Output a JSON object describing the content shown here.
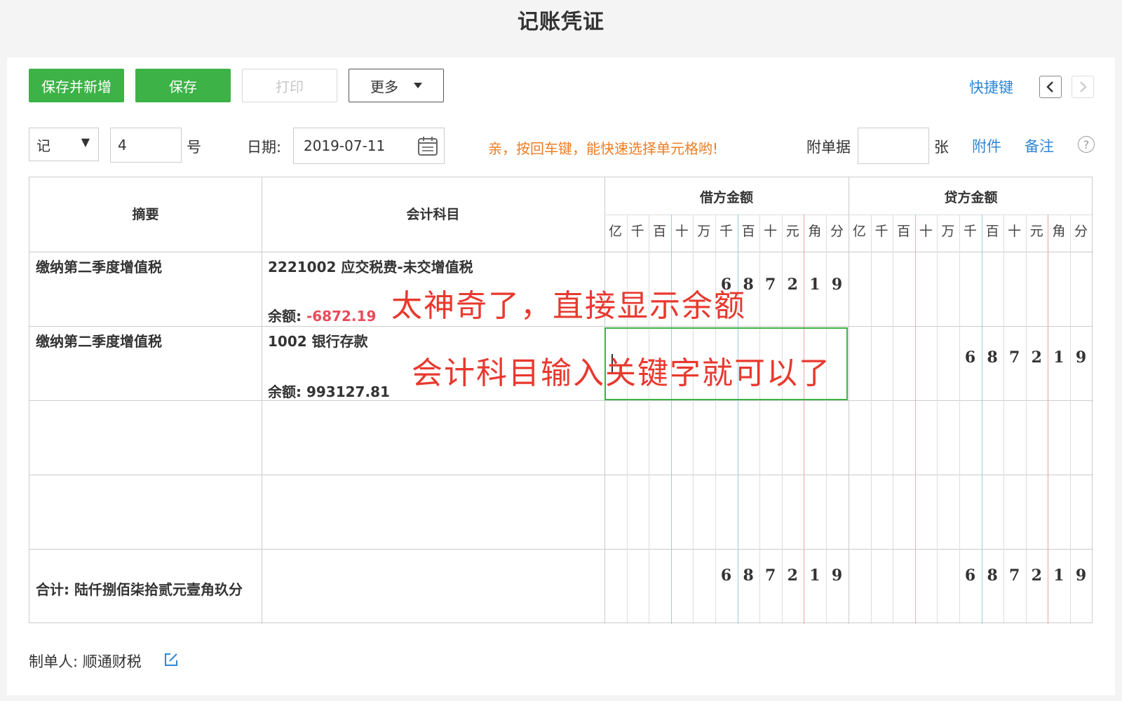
{
  "title": "记账凭证",
  "toolbar": {
    "save_new": "保存并新增",
    "save": "保存",
    "print": "打印",
    "more": "更多",
    "shortcut": "快捷键"
  },
  "voucher": {
    "type": "记",
    "number": "4",
    "number_suffix": "号",
    "date_label": "日期:",
    "date": "2019-07-11",
    "hint": "亲，按回车键，能快速选择单元格哟!",
    "attach_label": "附单据",
    "attach_count": "",
    "attach_unit": "张",
    "attachment_link": "附件",
    "remark_link": "备注",
    "help": "?"
  },
  "grid": {
    "col_summary": "摘要",
    "col_account": "会计科目",
    "col_debit": "借方金额",
    "col_credit": "贷方金额",
    "units": [
      "亿",
      "千",
      "百",
      "十",
      "万",
      "千",
      "百",
      "十",
      "元",
      "角",
      "分"
    ],
    "balance_label": "余额:",
    "rows": [
      {
        "summary": "缴纳第二季度增值税",
        "account": "2221002 应交税费-未交增值税",
        "balance": "-6872.19",
        "debit_digits": [
          "",
          "",
          "",
          "",
          "",
          "6",
          "8",
          "7",
          "2",
          "1",
          "9"
        ],
        "credit_digits": [
          "",
          "",
          "",
          "",
          "",
          "",
          "",
          "",
          "",
          "",
          ""
        ]
      },
      {
        "summary": "缴纳第二季度增值税",
        "account": "1002 银行存款",
        "balance": "993127.81",
        "debit_digits": [
          "",
          "",
          "",
          "",
          "",
          "",
          "",
          "",
          "",
          "",
          ""
        ],
        "credit_digits": [
          "",
          "",
          "",
          "",
          "",
          "6",
          "8",
          "7",
          "2",
          "1",
          "9"
        ]
      }
    ],
    "total_label": "合计: 陆仟捌佰柒拾贰元壹角玖分",
    "total_debit_digits": [
      "",
      "",
      "",
      "",
      "",
      "6",
      "8",
      "7",
      "2",
      "1",
      "9"
    ],
    "total_credit_digits": [
      "",
      "",
      "",
      "",
      "",
      "6",
      "8",
      "7",
      "2",
      "1",
      "9"
    ]
  },
  "annotations": {
    "note1": "太神奇了，直接显示余额",
    "note2": "会计科目输入关键字就可以了"
  },
  "footer": {
    "maker_label": "制单人:",
    "maker": "顺通财税"
  },
  "colors": {
    "green": "#3db247",
    "blue": "#2f86d6",
    "orange": "#f07c22",
    "red_note": "#e8392f",
    "negative": "#e84c5c"
  }
}
